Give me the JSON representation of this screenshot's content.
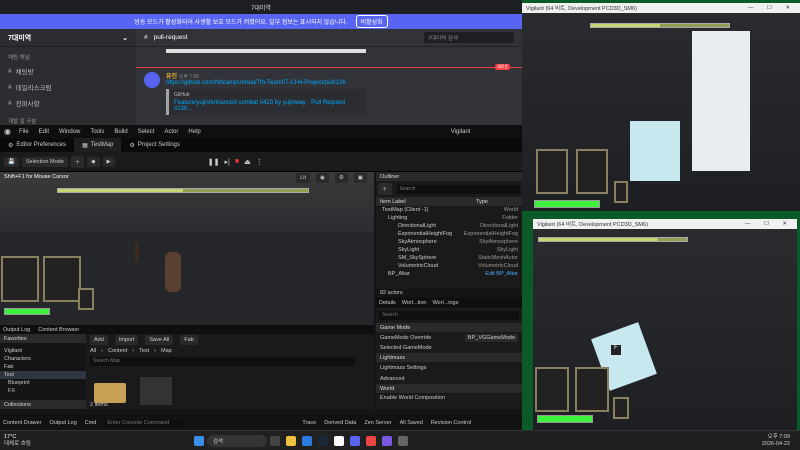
{
  "discord": {
    "title": "7대미역",
    "banner_text": "방송 모드가 활성화되어 사생활 보호 모드가 켜졌어요. 일부 정보는 표시되지 않습니다.",
    "banner_button": "비활성화",
    "server_name": "7대미역",
    "text_category": "채팅 채널",
    "channels": [
      "채팅방",
      "데일리스크럼",
      "전파사항"
    ],
    "voice_category": "개발 일 구분",
    "current_channel": "pull-request",
    "search_placeholder": "7대미역 검색",
    "msg_author": "유진",
    "msg_time": "오후 7:08",
    "msg_link": "https://github.com/NbcampUnreal/7th-Team07-CH4-Project/pull/136",
    "embed_site": "GitHub",
    "embed_title": "Feature/yujin/enhanced combat 0420 by yujinway · Pull Request #136...",
    "new_badge": "새로운"
  },
  "ue": {
    "menu": [
      "File",
      "Edit",
      "Window",
      "Tools",
      "Build",
      "Select",
      "Actor",
      "Help"
    ],
    "window_title": "Vigilant",
    "tabs": [
      "Editor Preferences",
      "TestMap",
      "Project Settings"
    ],
    "selection_mode": "Selection Mode",
    "viewport_hint": "Shift+F1 for Mouse Cursor",
    "lit": "Lit",
    "outliner_title": "Outliner",
    "outliner_search": "Search",
    "col_item": "Item Label",
    "col_type": "Type",
    "outliner_rows": [
      {
        "label": "TestMap (Client -1)",
        "type": "World"
      },
      {
        "label": "Lighting",
        "type": "Folder"
      },
      {
        "label": "DirectionalLight",
        "type": "DirectionalLight"
      },
      {
        "label": "ExponentialHeightFog",
        "type": "ExponentialHeightFog"
      },
      {
        "label": "SkyAtmosphere",
        "type": "SkyAtmosphere"
      },
      {
        "label": "SkyLight",
        "type": "SkyLight"
      },
      {
        "label": "SM_SkySphere",
        "type": "StaticMeshActor"
      },
      {
        "label": "VolumetricCloud",
        "type": "VolumetricCloud"
      },
      {
        "label": "BP_Altar",
        "type": "Edit BP_Altar"
      }
    ],
    "actor_count": "82 actors",
    "details_tabs": [
      "Details",
      "Worl...tion",
      "Worl...ings"
    ],
    "details_search": "Search",
    "game_mode_section": "Game Mode",
    "gm_override_label": "GameMode Override",
    "gm_override_value": "BP_VGGameMode",
    "selected_game_mode": "Selected GameMode",
    "lightmass": "Lightmass",
    "lightmass_settings": "Lightmass Settings",
    "advanced": "Advanced",
    "world": "World",
    "world_comp": "Enable World Composition",
    "bottom_tabs": [
      "Output Log",
      "Content Browser"
    ],
    "add": "Add",
    "import": "Import",
    "save_all": "Save All",
    "fab": "Fab",
    "path": [
      "All",
      "Content",
      "Test",
      "Map"
    ],
    "favorites": "Favorites",
    "project": "Vigilant",
    "folders": [
      "Characters",
      "Fab",
      "Test",
      "Blueprint",
      "FX"
    ],
    "search_map": "Search Map",
    "collections": "Collections",
    "items_count": "2 items",
    "status": {
      "content_drawer": "Content Drawer",
      "output_log": "Output Log",
      "cmd": "Cmd",
      "console_placeholder": "Enter Console Command",
      "trace": "Trace",
      "derived": "Derived Data",
      "zen": "Zen Server",
      "all_saved": "All Saved",
      "revision": "Revision Control"
    }
  },
  "game1": {
    "title": "Vigilant (64 비트, Development PCD3D_SM6)"
  },
  "game2": {
    "title": "Vigilant (64 비트, Development PCD3D_SM6)",
    "key": "F"
  },
  "taskbar": {
    "temp": "17°C",
    "weather": "대체로 흐림",
    "search": "검색",
    "time": "오후 7:09",
    "date": "2026-04-22"
  },
  "colors": {
    "discord_accent": "#5865f2",
    "hp_green": "#3ef33e",
    "taskbar": "#202020"
  }
}
